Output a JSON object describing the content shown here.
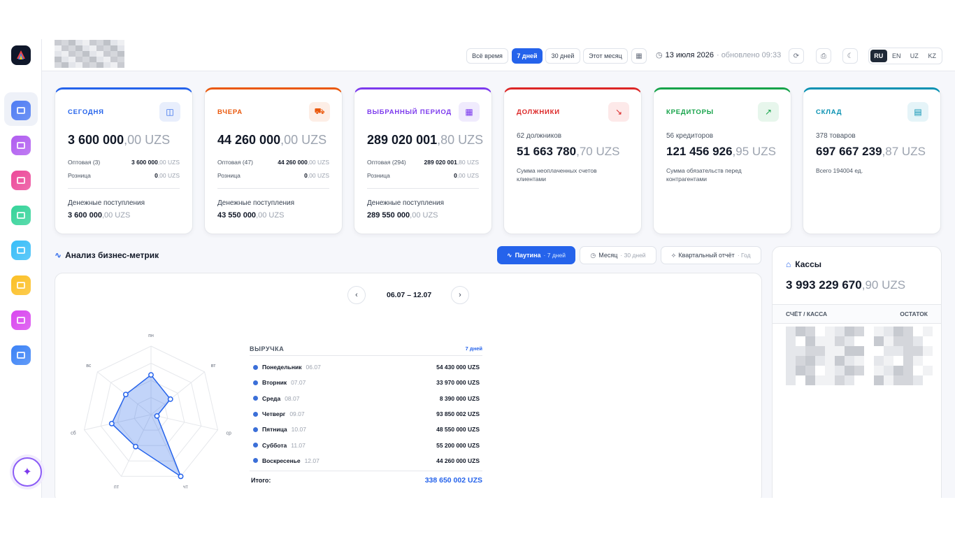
{
  "topbar": {
    "filters": [
      "Всё время",
      "7 дней",
      "30 дней",
      "Этот месяц"
    ],
    "active_filter": "7 дней",
    "date": "13 июля 2026",
    "updated": "· обновлено 09:33",
    "languages": [
      "RU",
      "EN",
      "UZ",
      "KZ"
    ],
    "active_language": "RU"
  },
  "sidebar": {
    "items": [
      {
        "icon": "dashboard-icon",
        "color": "#4f7cf3"
      },
      {
        "icon": "analytics-icon",
        "color": "#b05cf0"
      },
      {
        "icon": "table-icon",
        "color": "#ec4899"
      },
      {
        "icon": "transfer-icon",
        "color": "#34d399"
      },
      {
        "icon": "chart-icon",
        "color": "#38bdf8"
      },
      {
        "icon": "box-icon",
        "color": "#fbbf24"
      },
      {
        "icon": "magic-icon",
        "color": "#d946ef"
      },
      {
        "icon": "list-icon",
        "color": "#3b82f6"
      }
    ]
  },
  "cards": [
    {
      "title": "СЕГОДНЯ",
      "color": "#2563eb",
      "icon": "bag-icon",
      "value": "3 600 000",
      "dec": ",00",
      "cur": "UZS",
      "rows": [
        {
          "label": "Оптовая (3)",
          "value": "3 600 000",
          "dec": ",00 UZS"
        },
        {
          "label": "Розница",
          "value": "0",
          "dec": ",00 UZS"
        }
      ],
      "income_label": "Денежные поступления",
      "income_value": "3 600 000",
      "income_dec": ",00 UZS"
    },
    {
      "title": "ВЧЕРА",
      "color": "#ea580c",
      "icon": "cart-icon",
      "value": "44 260 000",
      "dec": ",00",
      "cur": "UZS",
      "rows": [
        {
          "label": "Оптовая (47)",
          "value": "44 260 000",
          "dec": ",00 UZS"
        },
        {
          "label": "Розница",
          "value": "0",
          "dec": ",00 UZS"
        }
      ],
      "income_label": "Денежные поступления",
      "income_value": "43 550 000",
      "income_dec": ",00 UZS"
    },
    {
      "title": "ВЫБРАННЫЙ ПЕРИОД",
      "color": "#7c3aed",
      "icon": "calendar-icon",
      "value": "289 020 001",
      "dec": ",80",
      "cur": "UZS",
      "rows": [
        {
          "label": "Оптовая (294)",
          "value": "289 020 001",
          "dec": ",80 UZS"
        },
        {
          "label": "Розница",
          "value": "0",
          "dec": ",00 UZS"
        }
      ],
      "income_label": "Денежные поступления",
      "income_value": "289 550 000",
      "income_dec": ",00 UZS"
    },
    {
      "title": "ДОЛЖНИКИ",
      "color": "#dc2626",
      "icon": "trending-down-icon",
      "sub": "62 должников",
      "value": "51 663 780",
      "dec": ",70",
      "cur": "UZS",
      "note": "Сумма неоплаченных счетов клиентами"
    },
    {
      "title": "КРЕДИТОРЫ",
      "color": "#16a34a",
      "icon": "trending-up-icon",
      "sub": "56 кредиторов",
      "value": "121 456 926",
      "dec": ",95",
      "cur": "UZS",
      "note": "Сумма обязательств перед контрагентами"
    },
    {
      "title": "СКЛАД",
      "color": "#0891b2",
      "icon": "archive-icon",
      "sub": "378 товаров",
      "value": "697 667 239",
      "dec": ",87",
      "cur": "UZS",
      "note": "Всего 194004 ед."
    }
  ],
  "metrics": {
    "title": "Анализ бизнес-метрик",
    "tabs": [
      {
        "label": "Паутина",
        "hint": "· 7 дней",
        "icon": "pulse-icon"
      },
      {
        "label": "Месяц",
        "hint": "· 30 дней",
        "icon": "clock-icon"
      },
      {
        "label": "Квартальный отчёт",
        "hint": "· Год",
        "icon": "compass-icon"
      }
    ],
    "week": "06.07 – 12.07",
    "revenue": {
      "title": "ВЫРУЧКА",
      "period": "7 дней",
      "rows": [
        {
          "day": "Понедельник",
          "date": "06.07",
          "value": "54 430 000 UZS"
        },
        {
          "day": "Вторник",
          "date": "07.07",
          "value": "33 970 000 UZS"
        },
        {
          "day": "Среда",
          "date": "08.07",
          "value": "8 390 000 UZS"
        },
        {
          "day": "Четверг",
          "date": "09.07",
          "value": "93 850 002 UZS"
        },
        {
          "day": "Пятница",
          "date": "10.07",
          "value": "48 550 000 UZS"
        },
        {
          "day": "Суббота",
          "date": "11.07",
          "value": "55 200 000 UZS"
        },
        {
          "day": "Воскресенье",
          "date": "12.07",
          "value": "44 260 000 UZS"
        }
      ],
      "total_label": "Итого:",
      "total_value": "338 650 002 UZS"
    }
  },
  "chart_data": {
    "type": "radar",
    "categories": [
      "пн",
      "вт",
      "ср",
      "чт",
      "пт",
      "сб",
      "вс"
    ],
    "values": [
      54430000,
      33970000,
      8390000,
      93850002,
      48550000,
      55200000,
      44260000
    ],
    "max": 93850002,
    "color": "#2563eb"
  },
  "kassy": {
    "title": "Кассы",
    "value": "3 993 229 670",
    "dec": ",90",
    "cur": "UZS",
    "col1": "СЧЁТ / КАССА",
    "col2": "ОСТАТОК"
  }
}
